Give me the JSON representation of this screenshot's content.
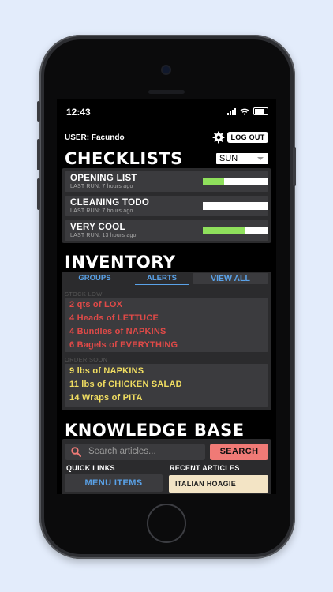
{
  "status": {
    "time": "12:43"
  },
  "user": {
    "label": "USER: Facundo",
    "logout_label": "LOG OUT"
  },
  "checklists": {
    "title": "CHECKLISTS",
    "day_selected": "SUN",
    "items": [
      {
        "name": "OPENING LIST",
        "last_run": "LAST RUN: 7 hours ago",
        "progress": 0.33
      },
      {
        "name": "CLEANING TODO",
        "last_run": "LAST RUN: 7 hours ago",
        "progress": 0.0
      },
      {
        "name": "VERY COOL",
        "last_run": "LAST RUN: 13 hours ago",
        "progress": 0.65
      }
    ]
  },
  "inventory": {
    "title": "INVENTORY",
    "tabs": [
      {
        "label": "GROUPS",
        "active": false
      },
      {
        "label": "ALERTS",
        "active": true
      },
      {
        "label": "VIEW ALL",
        "active": false
      }
    ],
    "stock_low": {
      "label": "STOCK LOW",
      "items": [
        "2 qts of LOX",
        "4 Heads of LETTUCE",
        "4 Bundles of NAPKINS",
        "6 Bagels of EVERYTHING"
      ]
    },
    "order_soon": {
      "label": "ORDER SOON",
      "items": [
        "9 lbs of NAPKINS",
        "11 lbs of CHICKEN SALAD",
        "14 Wraps of PITA"
      ]
    }
  },
  "knowledge": {
    "title": "KNOWLEDGE BASE",
    "search_placeholder": "Search articles...",
    "search_button": "SEARCH",
    "quick_links_label": "QUICK LINKS",
    "menu_items_label": "MENU ITEMS",
    "recent_articles_label": "RECENT ARTICLES",
    "recent_article": "ITALIAN HOAGIE"
  },
  "colors": {
    "accent_blue": "#5aa2e8",
    "alert_red": "#e04a48",
    "warn_yellow": "#f0dd61",
    "progress_green": "#8fe05c",
    "search_button": "#f07a76",
    "article_chip": "#f3e4c5"
  }
}
